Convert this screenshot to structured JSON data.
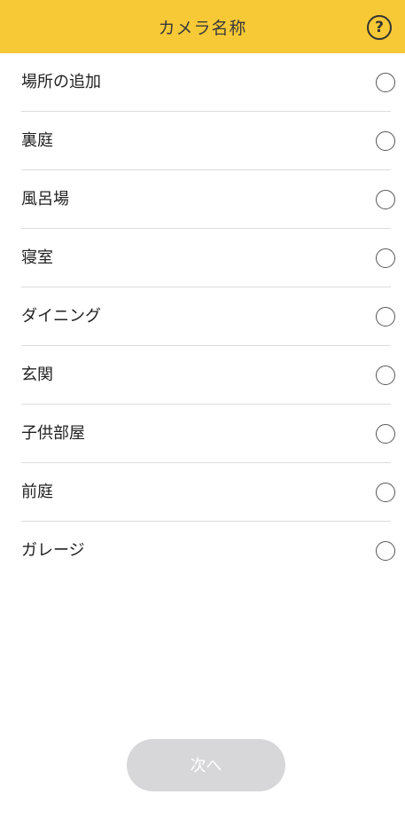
{
  "header": {
    "title": "カメラ名称",
    "help_label": "?"
  },
  "list": {
    "items": [
      {
        "label": "場所の追加",
        "selected": false
      },
      {
        "label": "裏庭",
        "selected": false
      },
      {
        "label": "風呂場",
        "selected": false
      },
      {
        "label": "寝室",
        "selected": false
      },
      {
        "label": "ダイニング",
        "selected": false
      },
      {
        "label": "玄関",
        "selected": false
      },
      {
        "label": "子供部屋",
        "selected": false
      },
      {
        "label": "前庭",
        "selected": false
      },
      {
        "label": "ガレージ",
        "selected": false
      }
    ]
  },
  "footer": {
    "next_label": "次へ",
    "next_enabled": false
  },
  "colors": {
    "header_bg": "#f8c936",
    "button_disabled_bg": "#d7d7d9"
  }
}
